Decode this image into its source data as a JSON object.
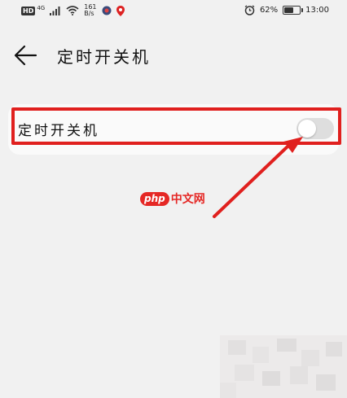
{
  "status_bar": {
    "network_badge": "HD",
    "network_type": "4G",
    "speed_value": "161",
    "speed_unit": "B/s",
    "battery_text": "62%",
    "battery_level": 0.62,
    "time": "13:00"
  },
  "header": {
    "back_icon": "back-arrow-icon",
    "title": "定时开关机"
  },
  "setting_row": {
    "label": "定时开关机",
    "toggle_on": false
  },
  "annotation": {
    "highlight_color": "#e0201e"
  },
  "watermark": {
    "logo": "php",
    "text": "中文网"
  }
}
